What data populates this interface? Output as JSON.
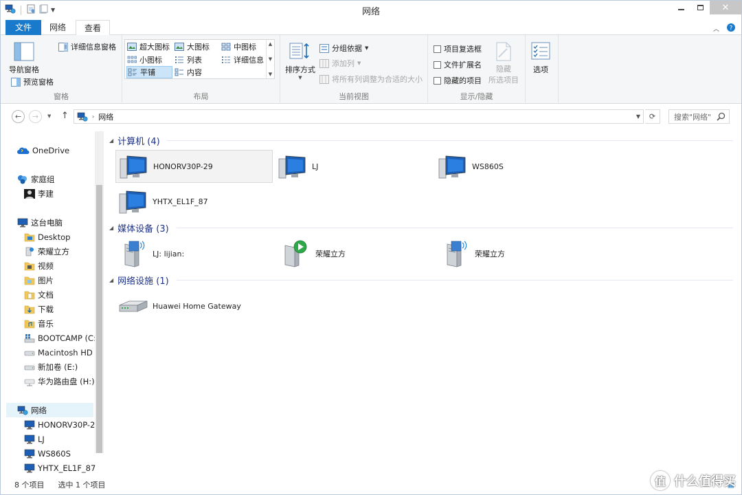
{
  "window": {
    "title": "网络"
  },
  "ribbon": {
    "tabs": [
      {
        "label": "文件",
        "active": false
      },
      {
        "label": "网络",
        "active": false
      },
      {
        "label": "查看",
        "active": true
      }
    ],
    "panes": {
      "nav_pane": "导航窗格",
      "preview_pane": "预览窗格",
      "details_pane": "详细信息窗格",
      "group_label": "窗格"
    },
    "layout": {
      "items": [
        "超大图标",
        "大图标",
        "中图标",
        "小图标",
        "列表",
        "详细信息",
        "平铺",
        "内容"
      ],
      "selected": "平铺",
      "group_label": "布局"
    },
    "current_view": {
      "sort_by": "排序方式",
      "group_by": "分组依据",
      "add_column": "添加列",
      "size_columns": "将所有列调整为合适的大小",
      "group_label": "当前视图"
    },
    "show_hide": {
      "item_checkboxes": "项目复选框",
      "file_extensions": "文件扩展名",
      "hidden_items": "隐藏的项目",
      "hide_selected_line1": "隐藏",
      "hide_selected_line2": "所选项目",
      "group_label": "显示/隐藏"
    },
    "options": "选项"
  },
  "address": {
    "path": "网络",
    "search_placeholder": "搜索\"网络\""
  },
  "nav_pane": {
    "onedrive": "OneDrive",
    "homegroup": "家庭组",
    "homegroup_user": "李建",
    "this_pc": "这台电脑",
    "pc_items": [
      "Desktop",
      "荣耀立方",
      "视频",
      "图片",
      "文档",
      "下载",
      "音乐",
      "BOOTCAMP (C:",
      "Macintosh HD (",
      "新加卷 (E:)",
      "华为路由盘 (H:)"
    ],
    "network": "网络",
    "network_items": [
      "HONORV30P-2",
      "LJ",
      "WS860S",
      "YHTX_EL1F_87"
    ]
  },
  "content": {
    "groups": [
      {
        "title": "计算机 (4)",
        "items": [
          "HONORV30P-29",
          "LJ",
          "WS860S",
          "YHTX_EL1F_87"
        ]
      },
      {
        "title": "媒体设备 (3)",
        "items": [
          "LJ: lijian:",
          "荣耀立方",
          "荣耀立方"
        ]
      },
      {
        "title": "网络设施 (1)",
        "items": [
          "Huawei Home Gateway"
        ]
      }
    ]
  },
  "status": {
    "item_count": "8 个项目",
    "selected": "选中 1 个项目"
  },
  "watermark": {
    "text": "什么值得买",
    "logo_glyph": "值"
  },
  "colors": {
    "accent": "#1979ca",
    "group_header": "#1e3287",
    "selection": "#cce4f7"
  }
}
